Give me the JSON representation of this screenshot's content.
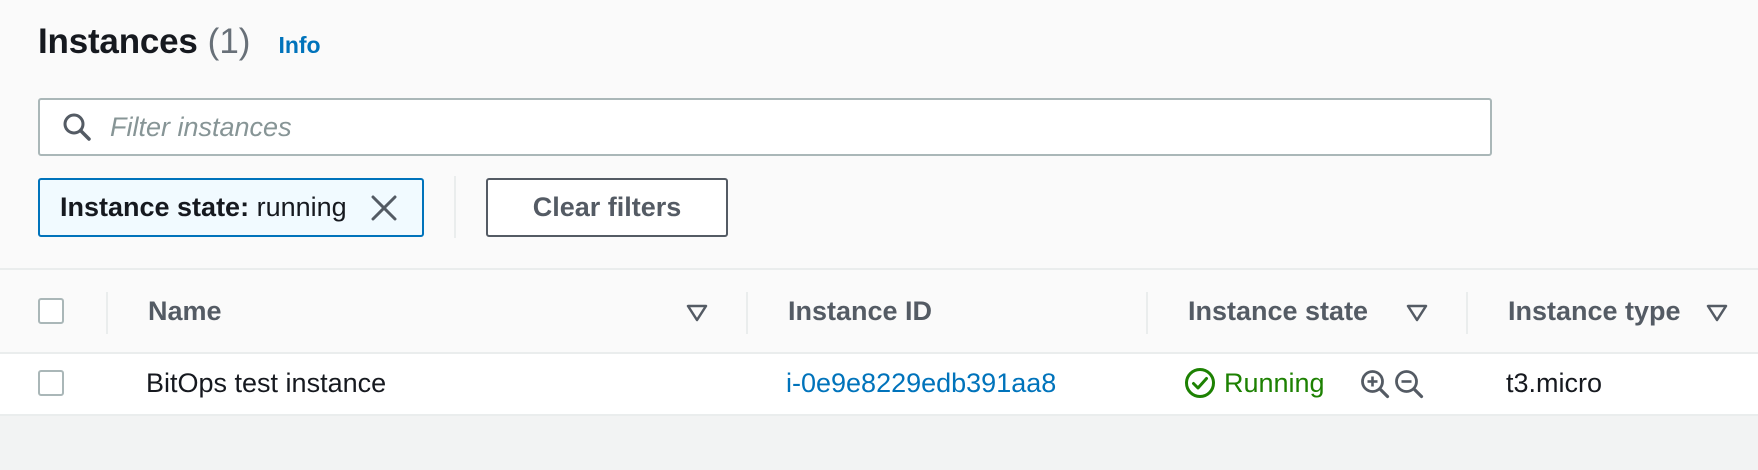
{
  "header": {
    "title": "Instances",
    "count": "(1)",
    "info_link": "Info"
  },
  "search": {
    "placeholder": "Filter instances",
    "value": ""
  },
  "filter_token": {
    "key": "Instance state:",
    "value": "running"
  },
  "clear_filters_label": "Clear filters",
  "table": {
    "columns": [
      "Name",
      "Instance ID",
      "Instance state",
      "Instance type"
    ],
    "rows": [
      {
        "name": "BitOps test instance",
        "instance_id": "i-0e9e8229edb391aa8",
        "instance_state": "Running",
        "instance_type": "t3.micro"
      }
    ]
  },
  "icons": {
    "search": "search-icon",
    "token_close": "close-icon",
    "sort": "caret-down-outline-icon",
    "status": "status-success-icon",
    "zoom_in": "zoom-in-icon",
    "zoom_out": "zoom-out-icon"
  },
  "colors": {
    "link": "#0073bb",
    "success": "#1d8102",
    "token_border": "#0073bb",
    "token_bg": "#f1faff",
    "header_text": "#545b64"
  }
}
